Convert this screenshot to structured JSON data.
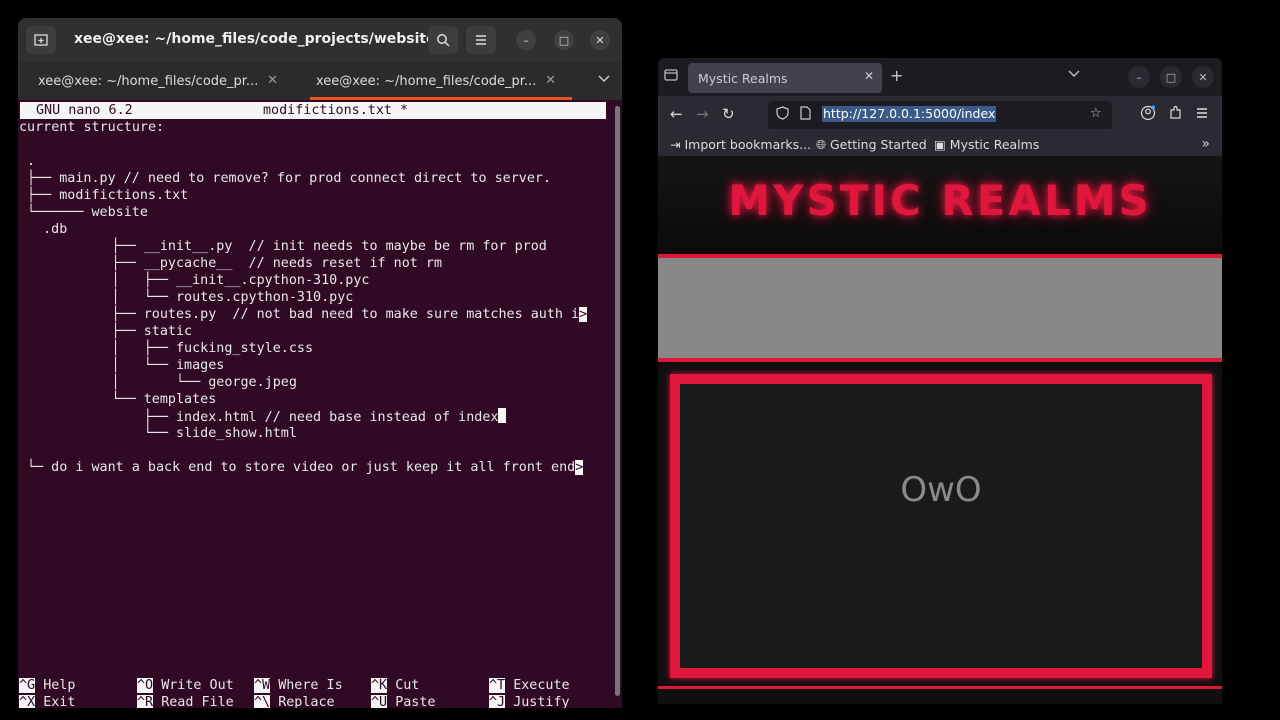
{
  "terminal": {
    "title": "xee@xee: ~/home_files/code_projects/website_...",
    "tabs": [
      {
        "label": "xee@xee: ~/home_files/code_pr..."
      },
      {
        "label": "xee@xee: ~/home_files/code_pr..."
      }
    ],
    "nano": {
      "version": "GNU nano 6.2",
      "filename": "modifictions.txt *"
    },
    "lines": [
      "current structure:",
      "",
      ".",
      "├── main.py // need to remove? for prod connect direct to server.",
      "├── modifictions.txt",
      "└────── website",
      "  .db",
      "        ├── __init__.py  // init needs to maybe be rm for prod",
      "        ├── __pycache__  // needs reset if not rm",
      "        │   ├── __init__.cpython-310.pyc",
      "        │   └── routes.cpython-310.pyc",
      "        ├── routes.py  // not bad need to make sure matches auth i",
      "        ├── static",
      "        │   ├── fucking_style.css",
      "        │   └── images",
      "        │       └── george.jpeg",
      "        └── templates",
      "            ├── index.html // need base instead of index",
      "            └── slide_show.html",
      "",
      "└─ do i want a back end to store video or just keep it all front end"
    ],
    "shortcuts": [
      {
        "key": "^G",
        "label": "Help"
      },
      {
        "key": "^X",
        "label": "Exit"
      },
      {
        "key": "^O",
        "label": "Write Out"
      },
      {
        "key": "^R",
        "label": "Read File"
      },
      {
        "key": "^W",
        "label": "Where Is"
      },
      {
        "key": "^\\",
        "label": "Replace"
      },
      {
        "key": "^K",
        "label": "Cut"
      },
      {
        "key": "^U",
        "label": "Paste"
      },
      {
        "key": "^T",
        "label": "Execute"
      },
      {
        "key": "^J",
        "label": "Justify"
      }
    ]
  },
  "browser": {
    "tab_title": "Mystic Realms",
    "url": "http://127.0.0.1:5000/index",
    "bookmarks": [
      {
        "label": "Import bookmarks..."
      },
      {
        "label": "Getting Started"
      },
      {
        "label": "Mystic Realms"
      }
    ],
    "page": {
      "site_title": "MYSTIC REALMS",
      "slide_text": "OwO"
    },
    "colors": {
      "accent": "#e0173d",
      "band": "#878787"
    }
  }
}
